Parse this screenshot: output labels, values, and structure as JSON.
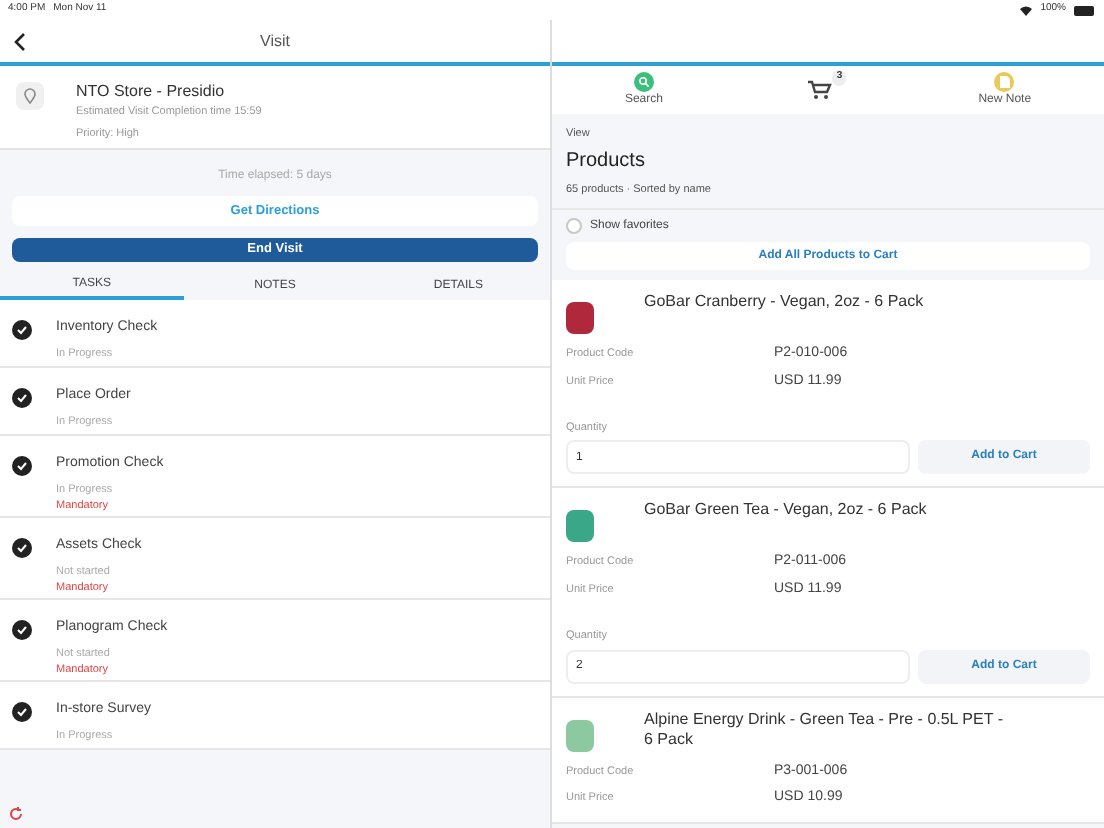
{
  "status_bar": {
    "time": "4:00 PM",
    "date": "Mon Nov 11",
    "battery": "100%"
  },
  "header": {
    "title": "Visit"
  },
  "visit": {
    "store": "NTO Store - Presidio",
    "completion": "Estimated Visit Completion time 15:59",
    "priority": "Priority: High",
    "elapsed": "Time elapsed: 5 days",
    "directions": "Get Directions",
    "end_visit": "End Visit"
  },
  "tabs": [
    {
      "label": "TASKS",
      "selected": true
    },
    {
      "label": "NOTES",
      "selected": false
    },
    {
      "label": "DETAILS",
      "selected": false
    }
  ],
  "tasks": [
    {
      "name": "Inventory Check",
      "status": "In Progress"
    },
    {
      "name": "Place Order",
      "status": "In Progress"
    },
    {
      "name": "Promotion Check",
      "status": "In Progress",
      "flag": "Mandatory"
    },
    {
      "name": "Assets Check",
      "status": "Not started",
      "flag": "Mandatory"
    },
    {
      "name": "Planogram Check",
      "status": "Not started",
      "flag": "Mandatory"
    },
    {
      "name": "In-store Survey",
      "status": "In Progress"
    }
  ],
  "toolbar": {
    "search": "Search",
    "cart_count": "3",
    "new_note": "New Note"
  },
  "products_view": {
    "view": "View",
    "title": "Products",
    "summary": "65 products · Sorted by name",
    "show_favorites": {
      "label": "Show favorites",
      "checked": false
    },
    "add_all": "Add All Products to Cart"
  },
  "products": [
    {
      "name": "GoBar Cranberry - Vegan, 2oz - 6 Pack",
      "color": "#b0283c",
      "code_label": "Product Code",
      "code": "P2-010-006",
      "price_label": "Unit Price",
      "price": "USD 11.99",
      "quantity_label": "Quantity",
      "quantity": "1",
      "add": "Add to Cart"
    },
    {
      "name": "GoBar Green Tea - Vegan, 2oz - 6 Pack",
      "color": "#3aa788",
      "code_label": "Product Code",
      "code": "P2-011-006",
      "price_label": "Unit Price",
      "price": "USD 11.99",
      "quantity_label": "Quantity",
      "quantity": "2",
      "add": "Add to Cart"
    },
    {
      "name": "Alpine Energy Drink - Green Tea - Pre - 0.5L PET - 6 Pack",
      "color": "#8cc9a0",
      "code_label": "Product Code",
      "code": "P3-001-006",
      "price_label": "Unit Price",
      "price": "USD 10.99"
    }
  ]
}
